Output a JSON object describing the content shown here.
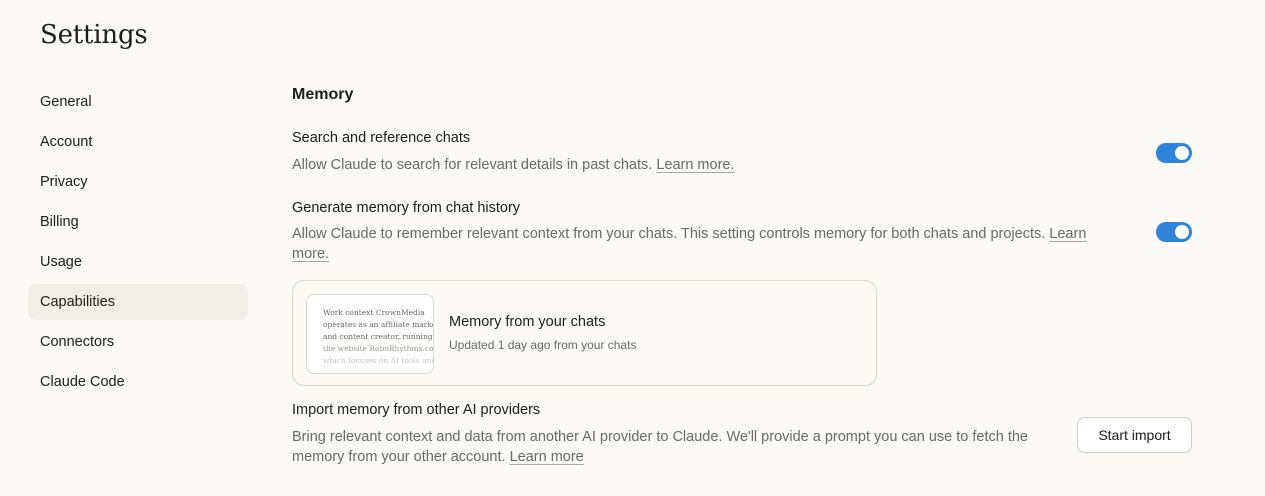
{
  "page": {
    "title": "Settings"
  },
  "sidebar": {
    "items": [
      {
        "label": "General"
      },
      {
        "label": "Account"
      },
      {
        "label": "Privacy"
      },
      {
        "label": "Billing"
      },
      {
        "label": "Usage"
      },
      {
        "label": "Capabilities",
        "active": true
      },
      {
        "label": "Connectors"
      },
      {
        "label": "Claude Code"
      }
    ]
  },
  "memory": {
    "section_title": "Memory",
    "search_chats": {
      "title": "Search and reference chats",
      "description": "Allow Claude to search for relevant details in past chats.",
      "link": "Learn more.",
      "enabled": true
    },
    "generate_memory": {
      "title": "Generate memory from chat history",
      "description": "Allow Claude to remember relevant context from your chats. This setting controls memory for both chats and projects.",
      "link": "Learn more.",
      "enabled": true
    },
    "memory_card": {
      "title": "Memory from your chats",
      "subtitle": "Updated 1 day ago from your chats",
      "preview_lines": [
        "Work context CrownMedia",
        "operates as an affiliate market",
        "and content creator, running",
        "the website RoboRhythms.co",
        "which focuses on AI tools and"
      ]
    },
    "import": {
      "title": "Import memory from other AI providers",
      "description": "Bring relevant context and data from another AI provider to Claude. We'll provide a prompt you can use to fetch the memory from your other account.",
      "link": "Learn more",
      "button_label": "Start import"
    }
  },
  "colors": {
    "background": "#faf9f5",
    "active_nav": "#f0eee6",
    "toggle_on": "#2c84db",
    "muted_text": "#6b6a66"
  }
}
